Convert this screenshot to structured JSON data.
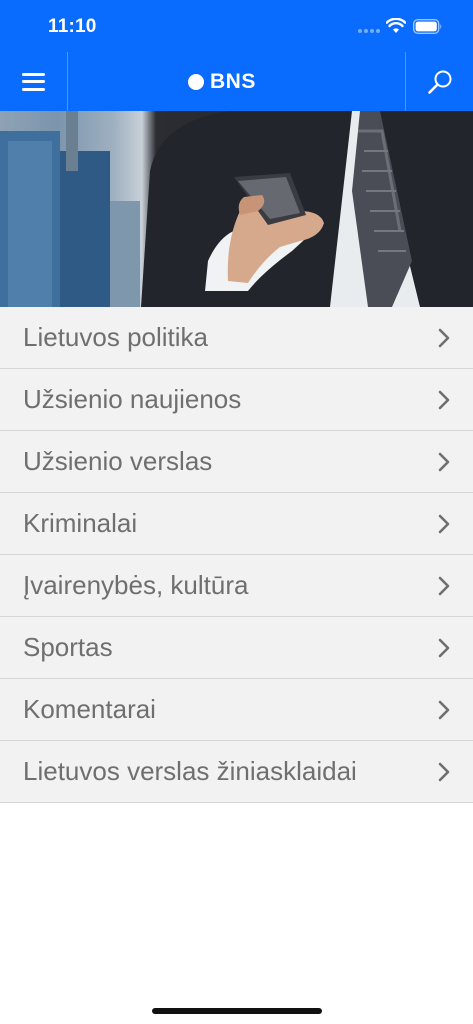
{
  "status_bar": {
    "time": "11:10"
  },
  "header": {
    "logo_text": "BNS"
  },
  "menu": {
    "items": [
      {
        "label": "Lietuvos politika"
      },
      {
        "label": "Užsienio naujienos"
      },
      {
        "label": "Užsienio verslas"
      },
      {
        "label": "Kriminalai"
      },
      {
        "label": "Įvairenybės, kultūra"
      },
      {
        "label": "Sportas"
      },
      {
        "label": "Komentarai"
      },
      {
        "label": "Lietuvos verslas žiniasklaidai"
      }
    ]
  },
  "colors": {
    "brand": "#0a6cff",
    "list_background": "#f2f2f2",
    "list_text": "#6f6f6f"
  },
  "icons": [
    "hamburger-icon",
    "search-icon",
    "chevron-right-icon",
    "wifi-icon",
    "battery-icon"
  ]
}
